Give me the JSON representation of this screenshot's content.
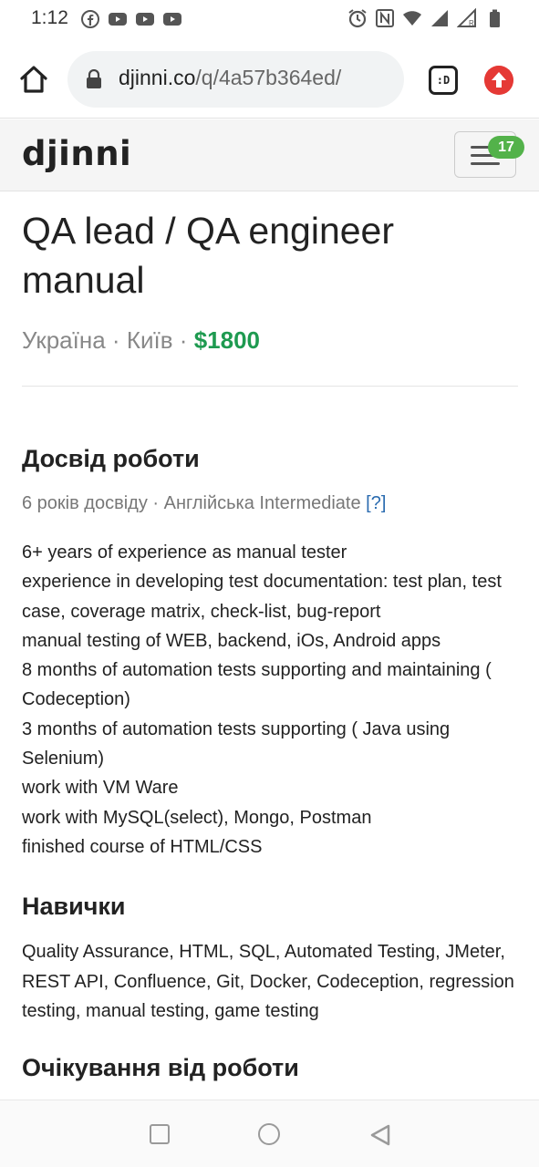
{
  "status_bar": {
    "time": "1:12",
    "left_icons": [
      "facebook-icon",
      "youtube-icon",
      "youtube-icon",
      "youtube-icon"
    ],
    "right_icons": [
      "alarm-icon",
      "nfc-icon",
      "wifi-icon",
      "signal-icon",
      "signal-roaming-icon",
      "battery-icon"
    ]
  },
  "browser": {
    "url_domain": "djinni.co",
    "url_path": "/q/4a57b364ed/",
    "tab_switcher_label": ":D",
    "colors": {
      "upload_button": "#e53935"
    }
  },
  "site": {
    "logo": "djinni",
    "menu_badge": "17",
    "colors": {
      "badge": "#53b24a",
      "salary": "#1e9a50",
      "link": "#2b6cb0"
    }
  },
  "job": {
    "title": "QA lead / QA engineer manual",
    "country": "Україна",
    "separator": "·",
    "city": "Київ",
    "salary": "$1800",
    "experience": {
      "heading": "Досвід роботи",
      "meta": "6 років досвіду · Англійська Intermediate",
      "help": "[?]",
      "lines": [
        "6+ years of experience as manual tester",
        "experience in developing test documentation: test plan, test case, coverage matrix, check-list, bug-report",
        "manual testing of WEB, backend, iOs, Android apps",
        "8 months of automation tests supporting and maintaining ( Codeception)",
        "3 months of automation tests supporting ( Java using Selenium)",
        "work with VM Ware",
        "work with MySQL(select), Mongo, Postman",
        "finished course of HTML/CSS"
      ]
    },
    "skills": {
      "heading": "Навички",
      "text": "Quality Assurance, HTML, SQL, Automated Testing, JMeter, REST API, Confluence, Git, Docker, Codeception, regression testing, manual testing, game testing"
    },
    "expectations": {
      "heading": "Очікування від роботи"
    }
  },
  "nav": {
    "icons": [
      "recents-icon",
      "home-icon",
      "back-icon"
    ]
  }
}
